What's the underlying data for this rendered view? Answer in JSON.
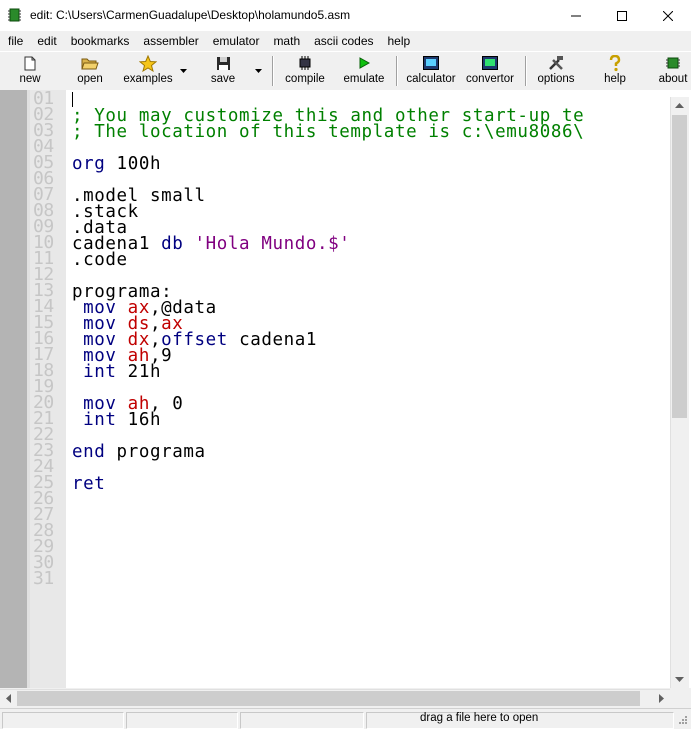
{
  "window": {
    "title": "edit: C:\\Users\\CarmenGuadalupe\\Desktop\\holamundo5.asm",
    "minimize_glyph": "—",
    "maximize_glyph": "☐",
    "close_glyph": "✕"
  },
  "menu": [
    "file",
    "edit",
    "bookmarks",
    "assembler",
    "emulator",
    "math",
    "ascii codes",
    "help"
  ],
  "toolbar": {
    "new": "new",
    "open": "open",
    "examples": "examples",
    "save": "save",
    "compile": "compile",
    "emulate": "emulate",
    "calculator": "calculator",
    "convertor": "convertor",
    "options": "options",
    "help": "help",
    "about": "about"
  },
  "line_numbers": [
    "01",
    "02",
    "03",
    "04",
    "05",
    "06",
    "07",
    "08",
    "09",
    "10",
    "11",
    "12",
    "13",
    "14",
    "15",
    "16",
    "17",
    "18",
    "19",
    "20",
    "21",
    "22",
    "23",
    "24",
    "25",
    "26",
    "27",
    "28",
    "29",
    "30",
    "31"
  ],
  "code": {
    "l02": "; You may customize this and other start-up te",
    "l03": "; The location of this template is c:\\emu8086\\",
    "l05a": "org",
    "l05b": " 100h",
    "l07": ".model small",
    "l08": ".stack",
    "l09": ".data",
    "l10a": "cadena1 ",
    "l10b": "db",
    "l10c": " 'Hola Mundo.$'",
    "l11": ".code",
    "l13": "programa:",
    "l14a": " mov",
    "l14b": " ax",
    "l14c": ",@data",
    "l15a": " mov",
    "l15b": " ds",
    "l15c": ",",
    "l15d": "ax",
    "l16a": " mov",
    "l16b": " dx",
    "l16c": ",",
    "l16d": "offset",
    "l16e": " cadena1",
    "l17a": " mov",
    "l17b": " ah",
    "l17c": ",9",
    "l18a": " int",
    "l18b": " 21h",
    "l20a": " mov",
    "l20b": " ah",
    "l20c": ", 0",
    "l21a": " int",
    "l21b": " 16h",
    "l23a": "end",
    "l23b": " programa",
    "l25": "ret"
  },
  "status": {
    "hint": "drag a file here to open"
  },
  "colors": {
    "comment": "#008000",
    "keyword": "#000080",
    "register": "#c00000",
    "string": "#800080",
    "gutter": "#b4b4b4"
  }
}
